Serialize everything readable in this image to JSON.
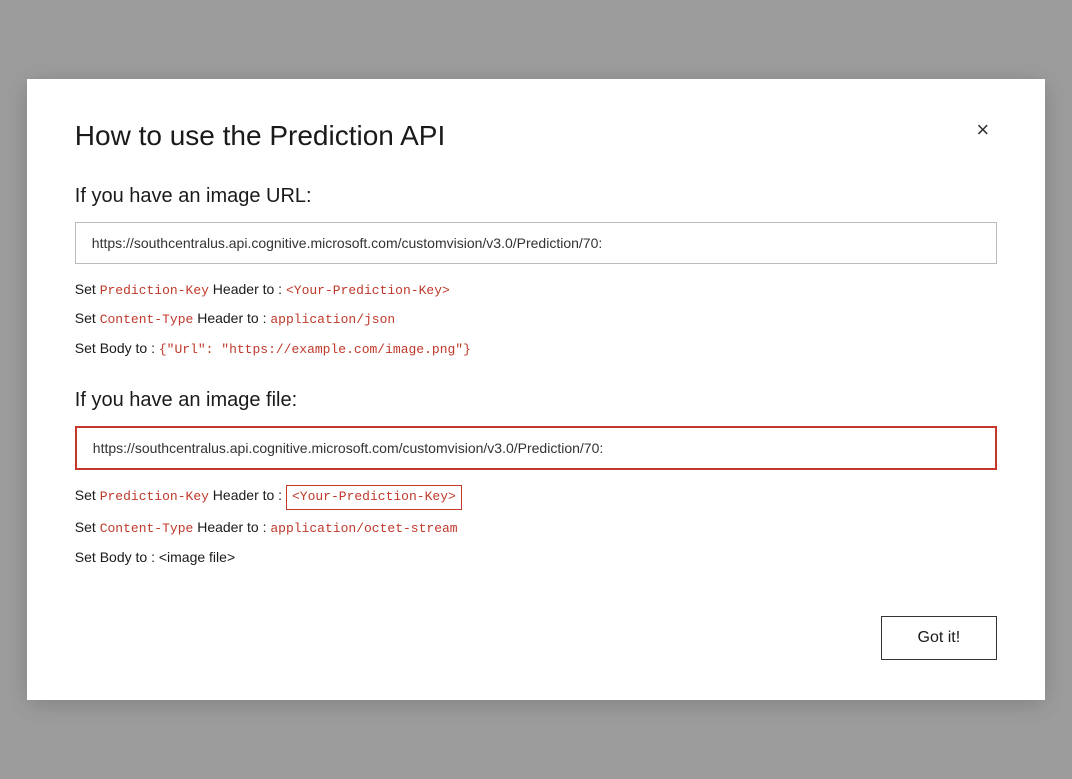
{
  "dialog": {
    "title": "How to use the Prediction API",
    "close_label": "×"
  },
  "section_url": {
    "heading": "If you have an image URL:",
    "url": "https://southcentralus.api.cognitive.microsoft.com/customvision/v3.0/Prediction/70:",
    "lines": [
      {
        "prefix": "Set ",
        "key": "Prediction-Key",
        "middle": " Header to : ",
        "value": "<Your-Prediction-Key>",
        "value_boxed": false
      },
      {
        "prefix": "Set ",
        "key": "Content-Type",
        "middle": " Header to : ",
        "value": "application/json",
        "value_boxed": false
      },
      {
        "prefix": "Set Body to : ",
        "key": null,
        "middle": null,
        "value": "{\"Url\": \"https://example.com/image.png\"}",
        "value_boxed": false
      }
    ]
  },
  "section_file": {
    "heading": "If you have an image file:",
    "url": "https://southcentralus.api.cognitive.microsoft.com/customvision/v3.0/Prediction/70:",
    "lines": [
      {
        "prefix": "Set ",
        "key": "Prediction-Key",
        "middle": " Header to : ",
        "value": "<Your-Prediction-Key>",
        "value_boxed": true
      },
      {
        "prefix": "Set ",
        "key": "Content-Type",
        "middle": " Header to : ",
        "value": "application/octet-stream",
        "value_boxed": false
      },
      {
        "prefix": "Set Body to : <image file>",
        "key": null,
        "middle": null,
        "value": null,
        "value_boxed": false
      }
    ]
  },
  "footer": {
    "got_it_label": "Got it!"
  }
}
